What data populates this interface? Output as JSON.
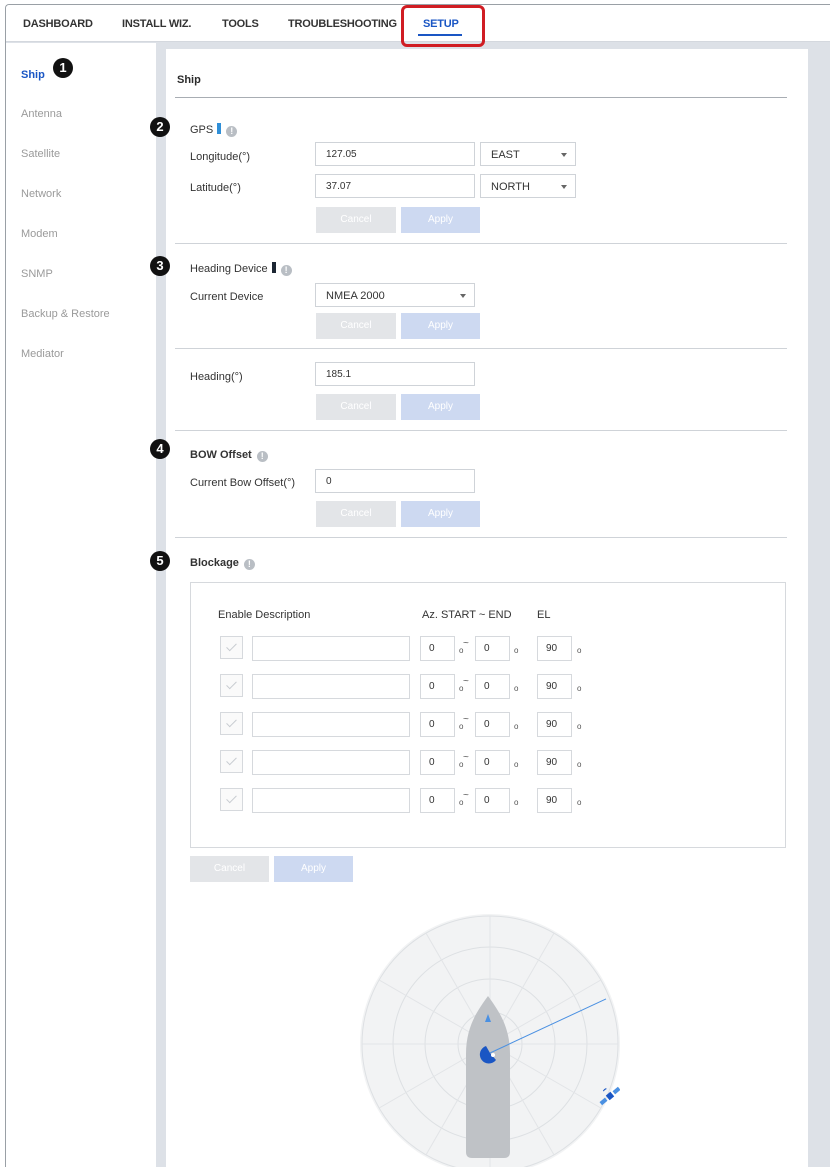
{
  "topnav": {
    "tabs": [
      "DASHBOARD",
      "INSTALL WIZ.",
      "TOOLS",
      "TROUBLESHOOTING",
      "SETUP"
    ],
    "active": "SETUP"
  },
  "sidebar": {
    "items": [
      "Ship",
      "Antenna",
      "Satellite",
      "Network",
      "Modem",
      "SNMP",
      "Backup & Restore",
      "Mediator"
    ],
    "active": "Ship"
  },
  "callouts": [
    "1",
    "2",
    "3",
    "4",
    "5"
  ],
  "page": {
    "title": "Ship"
  },
  "gps": {
    "title": "GPS",
    "marker_color": "#2f8fd8",
    "longitude_label": "Longitude(°)",
    "longitude_value": "127.05",
    "longitude_dir": "EAST",
    "latitude_label": "Latitude(°)",
    "latitude_value": "37.07",
    "latitude_dir": "NORTH",
    "cancel": "Cancel",
    "apply": "Apply"
  },
  "heading_device": {
    "title": "Heading Device",
    "marker_color": "#1c2633",
    "current_label": "Current Device",
    "current_value": "NMEA 2000",
    "cancel": "Cancel",
    "apply": "Apply"
  },
  "heading": {
    "label": "Heading(°)",
    "value": "185.1",
    "cancel": "Cancel",
    "apply": "Apply"
  },
  "bow_offset": {
    "title": "BOW Offset",
    "label": "Current Bow Offset(°)",
    "value": "0",
    "cancel": "Cancel",
    "apply": "Apply"
  },
  "blockage": {
    "title": "Blockage",
    "headers": {
      "enable_description": "Enable Description",
      "az": "Az. START ~ END",
      "el": "EL"
    },
    "rows": [
      {
        "start": "0",
        "end": "0",
        "el": "90"
      },
      {
        "start": "0",
        "end": "0",
        "el": "90"
      },
      {
        "start": "0",
        "end": "0",
        "el": "90"
      },
      {
        "start": "0",
        "end": "0",
        "el": "90"
      },
      {
        "start": "0",
        "end": "0",
        "el": "90"
      }
    ],
    "deg_symbol": "o",
    "tilde": "~",
    "cancel": "Cancel",
    "apply": "Apply"
  },
  "radar": {
    "heading_deg": 185.1,
    "antenna_line_deg": 65,
    "colors": {
      "accent": "#1a56c4",
      "hull": "#bfc2c6",
      "rings": "#dde0e3",
      "bg": "#f2f3f4"
    }
  },
  "colors": {
    "accent": "#1a56c4",
    "highlight": "#d01d23"
  }
}
